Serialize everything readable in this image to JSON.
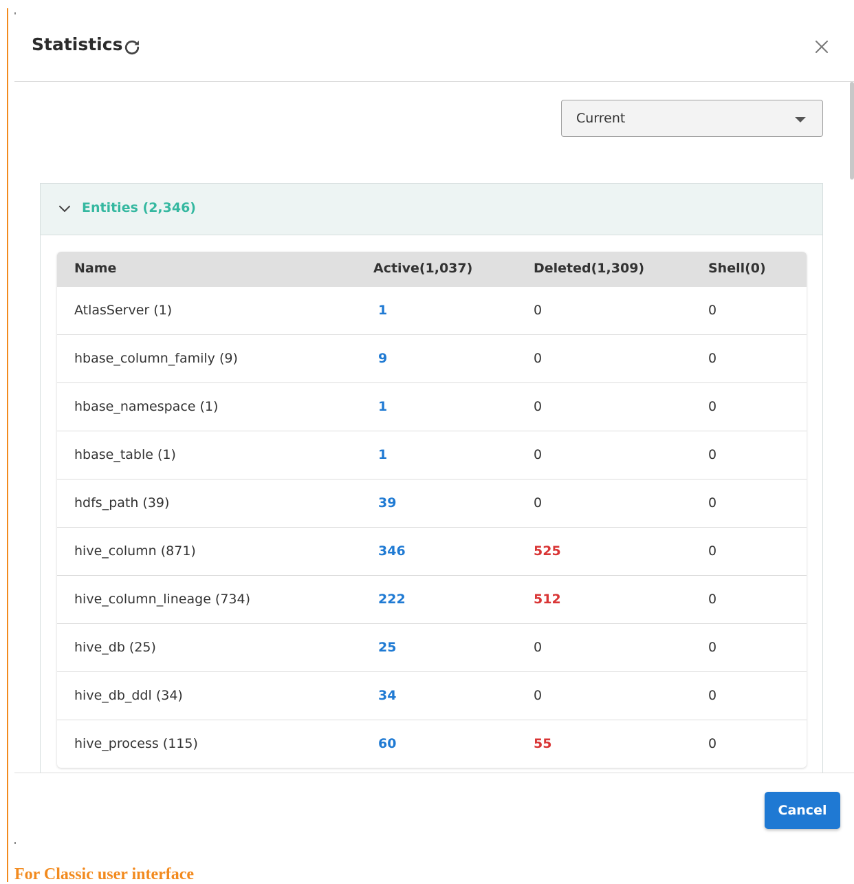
{
  "dialog": {
    "title": "Statistics",
    "close_icon": "close-icon",
    "refresh_icon": "refresh-icon"
  },
  "filter": {
    "selected": "Current"
  },
  "entities_panel": {
    "title": "Entities (2,346)",
    "columns": [
      "Name",
      "Active(1,037)",
      "Deleted(1,309)",
      "Shell(0)"
    ],
    "rows": [
      {
        "name": "AtlasServer (1)",
        "active": "1",
        "deleted": "0",
        "shell": "0"
      },
      {
        "name": "hbase_column_family (9)",
        "active": "9",
        "deleted": "0",
        "shell": "0"
      },
      {
        "name": "hbase_namespace (1)",
        "active": "1",
        "deleted": "0",
        "shell": "0"
      },
      {
        "name": "hbase_table (1)",
        "active": "1",
        "deleted": "0",
        "shell": "0"
      },
      {
        "name": "hdfs_path (39)",
        "active": "39",
        "deleted": "0",
        "shell": "0"
      },
      {
        "name": "hive_column (871)",
        "active": "346",
        "deleted": "525",
        "shell": "0"
      },
      {
        "name": "hive_column_lineage (734)",
        "active": "222",
        "deleted": "512",
        "shell": "0"
      },
      {
        "name": "hive_db (25)",
        "active": "25",
        "deleted": "0",
        "shell": "0"
      },
      {
        "name": "hive_db_ddl (34)",
        "active": "34",
        "deleted": "0",
        "shell": "0"
      },
      {
        "name": "hive_process (115)",
        "active": "60",
        "deleted": "55",
        "shell": "0"
      }
    ]
  },
  "footer": {
    "cancel_label": "Cancel"
  },
  "caption": "For Classic user interface",
  "colors": {
    "accent_teal": "#35b8a0",
    "active_blue": "#1f7ad3",
    "deleted_red": "#d93535",
    "button_blue": "#1f79d3",
    "orange": "#f28a1e"
  }
}
